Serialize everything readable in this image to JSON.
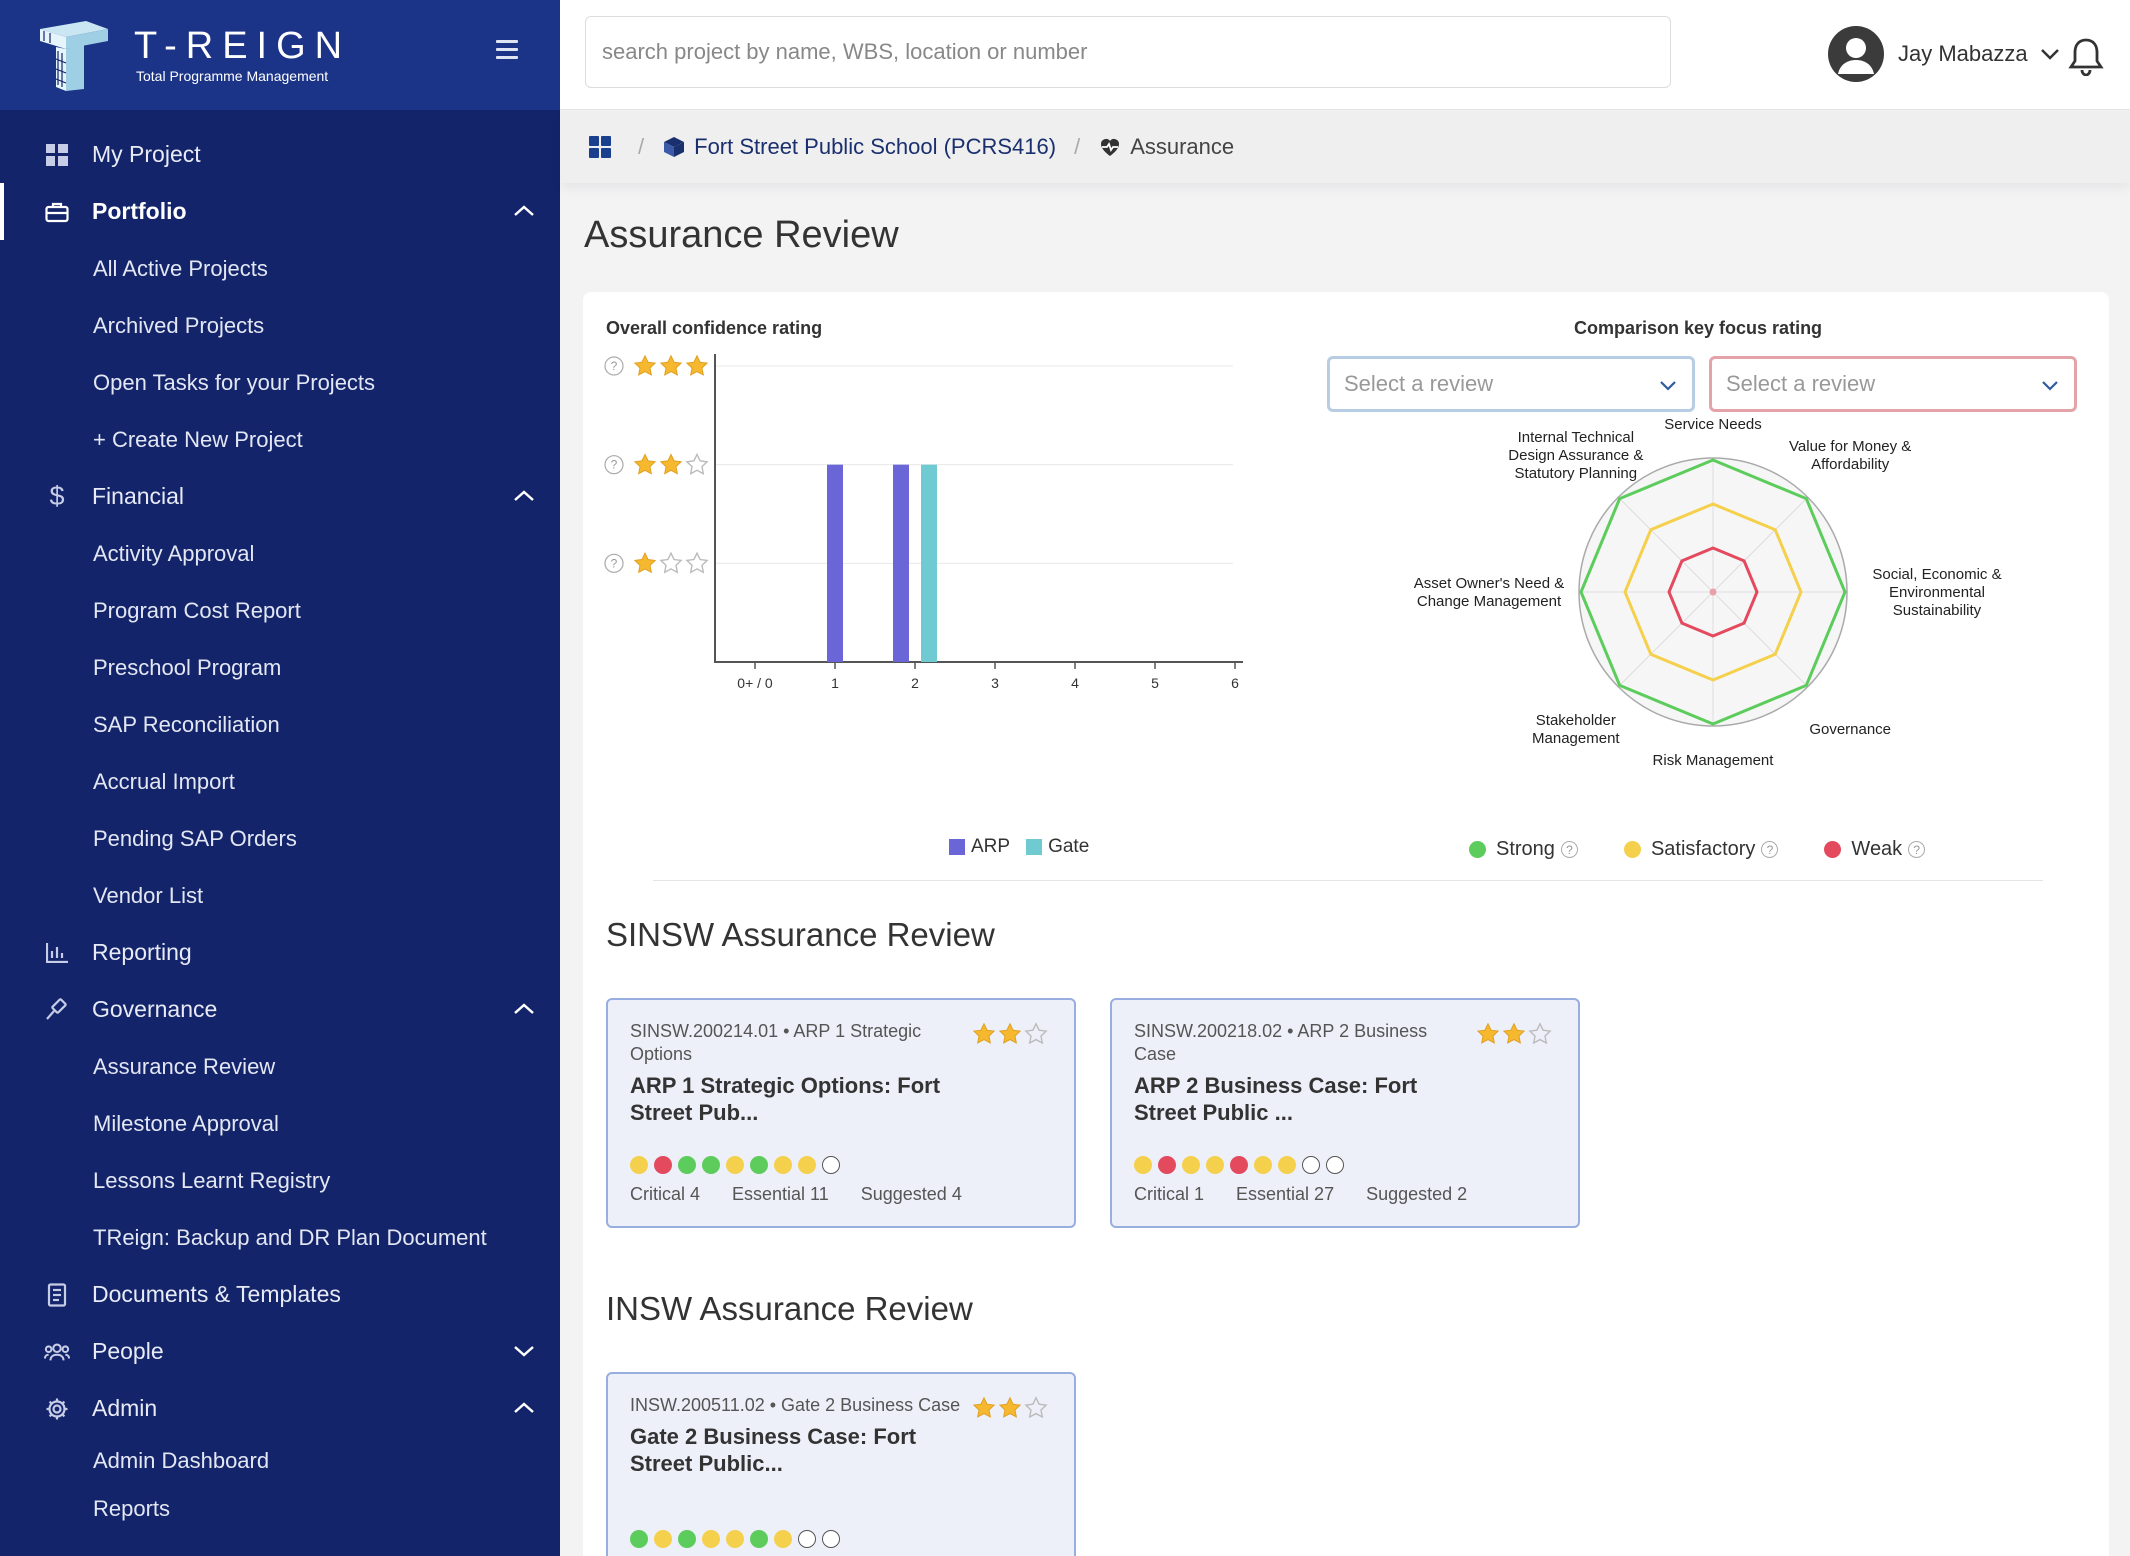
{
  "app": {
    "brand_name": "T-REIGN",
    "brand_sub": "Total Programme Management"
  },
  "search": {
    "placeholder": "search project by name, WBS, location or number"
  },
  "user": {
    "name": "Jay Mabazza"
  },
  "sidebar": {
    "items": [
      {
        "label": "My Project",
        "icon": "grid-icon"
      },
      {
        "label": "Portfolio",
        "icon": "briefcase-icon",
        "active": true,
        "expanded": true,
        "children": [
          "All Active Projects",
          "Archived Projects",
          "Open Tasks for your Projects",
          "+ Create New Project"
        ]
      },
      {
        "label": "Financial",
        "icon": "dollar-icon",
        "expanded": true,
        "children": [
          "Activity Approval",
          "Program Cost Report",
          "Preschool Program",
          "SAP Reconciliation",
          "Accrual Import",
          "Pending SAP Orders",
          "Vendor List"
        ]
      },
      {
        "label": "Reporting",
        "icon": "chart-icon"
      },
      {
        "label": "Governance",
        "icon": "gavel-icon",
        "expanded": true,
        "children": [
          "Assurance Review",
          "Milestone Approval",
          "Lessons Learnt Registry",
          "TReign: Backup and DR Plan Document"
        ]
      },
      {
        "label": "Documents & Templates",
        "icon": "document-icon"
      },
      {
        "label": "People",
        "icon": "people-icon",
        "expanded": false
      },
      {
        "label": "Admin",
        "icon": "gear-icon",
        "expanded": true,
        "children": [
          "Admin Dashboard",
          "Reports"
        ]
      }
    ]
  },
  "breadcrumb": {
    "project": "Fort Street Public School (PCRS416)",
    "current": "Assurance"
  },
  "page": {
    "title": "Assurance Review"
  },
  "confidence": {
    "title": "Overall confidence rating"
  },
  "comparison": {
    "title": "Comparison key focus rating",
    "select_a": "Select a review",
    "select_b": "Select a review"
  },
  "chart_data": [
    {
      "type": "bar",
      "title": "Overall confidence rating",
      "categories": [
        "0+ / 0",
        "1",
        "2",
        "3",
        "4",
        "5",
        "6"
      ],
      "y_levels": [
        "1 star",
        "2 stars",
        "3 stars"
      ],
      "ylim": [
        0,
        3
      ],
      "series": [
        {
          "name": "ARP",
          "color": "#6b66d8",
          "values": [
            null,
            2,
            2,
            null,
            null,
            null,
            null
          ]
        },
        {
          "name": "Gate",
          "color": "#6fcbd1",
          "values": [
            null,
            null,
            2,
            null,
            null,
            null,
            null
          ]
        }
      ],
      "legend": "bottom",
      "grid": true
    },
    {
      "type": "radar",
      "title": "Comparison key focus rating",
      "axes": [
        "Service Needs",
        "Value for Money & Affordability",
        "Social, Economic & Environmental Sustainability",
        "Governance",
        "Risk Management",
        "Stakeholder Management",
        "Asset Owner's Need & Change Management",
        "Internal Technical Design Assurance & Statutory Planning"
      ],
      "levels": [
        {
          "name": "Strong",
          "color": "#5ccc5c",
          "value": 3
        },
        {
          "name": "Satisfactory",
          "color": "#f5d04c",
          "value": 2
        },
        {
          "name": "Weak",
          "color": "#e44a5e",
          "value": 1
        }
      ],
      "legend": "bottom"
    }
  ],
  "sections": [
    {
      "heading": "SINSW Assurance Review",
      "reviews": [
        {
          "code": "SINSW.200214.01 • ARP 1 Strategic Options",
          "title": "ARP 1 Strategic Options: Fort Street Pub...",
          "stars": 2,
          "dots": [
            "#f5d04c",
            "#e44a5e",
            "#5ccc5c",
            "#5ccc5c",
            "#f5d04c",
            "#5ccc5c",
            "#f5d04c",
            "#f5d04c",
            "empty"
          ],
          "critical": "Critical 4",
          "essential": "Essential 11",
          "suggested": "Suggested 4"
        },
        {
          "code": "SINSW.200218.02 • ARP 2 Business Case",
          "title": "ARP 2 Business Case: Fort Street Public ...",
          "stars": 2,
          "dots": [
            "#f5d04c",
            "#e44a5e",
            "#f5d04c",
            "#f5d04c",
            "#e44a5e",
            "#f5d04c",
            "#f5d04c",
            "empty",
            "empty"
          ],
          "critical": "Critical 1",
          "essential": "Essential 27",
          "suggested": "Suggested 2"
        }
      ]
    },
    {
      "heading": "INSW Assurance Review",
      "reviews": [
        {
          "code": "INSW.200511.02 • Gate 2 Business Case",
          "title": "Gate 2 Business Case: Fort Street Public...",
          "stars": 2,
          "dots": [
            "#5ccc5c",
            "#f5d04c",
            "#5ccc5c",
            "#f5d04c",
            "#f5d04c",
            "#5ccc5c",
            "#f5d04c",
            "empty",
            "empty"
          ]
        }
      ]
    }
  ],
  "colors": {
    "sidebar": "#13246a",
    "brand_bar": "#1b3487",
    "star": "#f5b82e",
    "arp": "#6b66d8",
    "gate": "#6fcbd1",
    "strong": "#5ccc5c",
    "satisfactory": "#f5d04c",
    "weak": "#e44a5e"
  }
}
